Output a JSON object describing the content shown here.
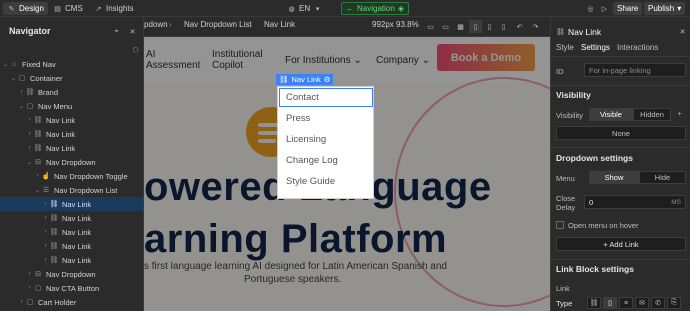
{
  "topbar": {
    "design_tab": "Design",
    "cms_tab": "CMS",
    "insights_tab": "Insights",
    "breadcrumb": [
      "Nav Dropdown List",
      "Nav Link"
    ],
    "breadcrumb_lead": "pdown",
    "locale": "EN",
    "mode_pill": "Navigation",
    "canvas_size": "992px 93.8%",
    "share_label": "Share",
    "publish_label": "Publish"
  },
  "navigator": {
    "title": "Navigator",
    "items": [
      {
        "label": "Fixed Nav",
        "indent": 0,
        "icon": "home-icon"
      },
      {
        "label": "Container",
        "indent": 1,
        "icon": "box-icon"
      },
      {
        "label": "Brand",
        "indent": 2,
        "icon": "link-icon"
      },
      {
        "label": "Nav Menu",
        "indent": 2,
        "icon": "box-icon"
      },
      {
        "label": "Nav Link",
        "indent": 3,
        "icon": "link-icon"
      },
      {
        "label": "Nav Link",
        "indent": 3,
        "icon": "link-icon"
      },
      {
        "label": "Nav Link",
        "indent": 3,
        "icon": "link-icon"
      },
      {
        "label": "Nav Dropdown",
        "indent": 3,
        "icon": "dropdown-icon"
      },
      {
        "label": "Nav Dropdown Toggle",
        "indent": 4,
        "icon": "pointer-icon"
      },
      {
        "label": "Nav Dropdown List",
        "indent": 4,
        "icon": "list-icon"
      },
      {
        "label": "Nav Link",
        "indent": 5,
        "icon": "link-icon",
        "selected": true
      },
      {
        "label": "Nav Link",
        "indent": 5,
        "icon": "link-icon"
      },
      {
        "label": "Nav Link",
        "indent": 5,
        "icon": "link-icon"
      },
      {
        "label": "Nav Link",
        "indent": 5,
        "icon": "link-icon"
      },
      {
        "label": "Nav Link",
        "indent": 5,
        "icon": "link-icon"
      },
      {
        "label": "Nav Dropdown",
        "indent": 3,
        "icon": "dropdown-icon"
      },
      {
        "label": "Nav CTA Button",
        "indent": 3,
        "icon": "box-icon"
      },
      {
        "label": "Cart Holder",
        "indent": 2,
        "icon": "box-icon"
      }
    ]
  },
  "canvas": {
    "nav_ai_1": "AI",
    "nav_ai_2": "Assessment",
    "nav_inst_1": "Institutional",
    "nav_inst_2": "Copilot",
    "nav_institutions": "For Institutions",
    "nav_company": "Company",
    "cta_label": "Book a Demo",
    "selected_tag": "Nav Link",
    "dropdown_items": [
      "Contact",
      "Press",
      "Licensing",
      "Change Log",
      "Style Guide"
    ],
    "hero_line1": "owered Language",
    "hero_line2": "arning Platform",
    "sub_line1": "s first language learning AI designed for Latin American Spanish and",
    "sub_line2": "Portuguese speakers."
  },
  "panel": {
    "element_name": "Nav Link",
    "tabs": [
      "Style",
      "Settings",
      "Interactions"
    ],
    "active_tab": "Settings",
    "id_label": "ID",
    "id_placeholder": "For in-page linking",
    "visibility_title": "Visibility",
    "visibility_label": "Visibility",
    "visible_label": "Visible",
    "hidden_label": "Hidden",
    "none_label": "None",
    "dropdown_title": "Dropdown settings",
    "menu_label": "Menu",
    "show_label": "Show",
    "hide_label": "Hide",
    "close_delay_label_1": "Close",
    "close_delay_label_2": "Delay",
    "close_delay_value": "0",
    "close_delay_unit": "MS",
    "open_on_hover": "Open menu on hover",
    "add_link": "+ Add Link",
    "link_block_title": "Link Block settings",
    "link_label": "Link",
    "type_label": "Type"
  },
  "colors": {
    "accent_blue": "#3b82f6",
    "cta_start": "#f64f7a",
    "cta_end": "#f7a14a",
    "nav_green": "#5fd37a",
    "hero_text": "#10264a"
  }
}
